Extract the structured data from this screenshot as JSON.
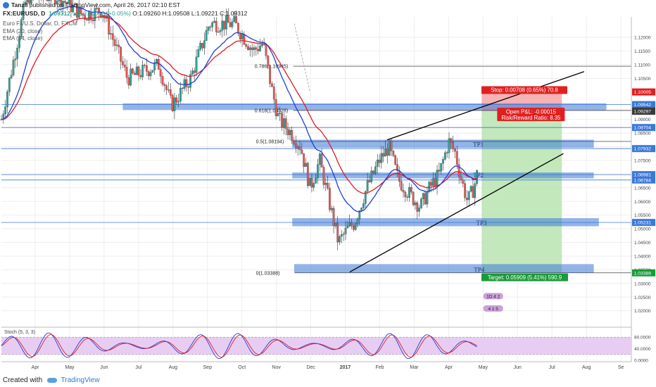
{
  "header": {
    "author": "Tanzil",
    "published_text": "published on TradingView.com, April 26, 2017 02:10 EST",
    "symbol_line": "FX:EURUSD, D",
    "price": "1.09312",
    "change": "+0.00052 (+0.05%)",
    "ohlc": "O:1.09260 H:1.09508 L:1.09221 C:1.09312"
  },
  "legend": {
    "line1": "Euro Fx/U.S. Dollar, D, FXCM",
    "line2": "EMA (20, close)",
    "line3": "EMA (34, close)"
  },
  "colors": {
    "up_candle": "#26a69a",
    "down_candle": "#ef5350",
    "ema20": "#1f3fd6",
    "ema34": "#e01b24",
    "zone": "#3c78d8",
    "stop_zone": "#f4a6a6",
    "target_zone": "#b7e4b0",
    "stoch_band": "#e6c8f2"
  },
  "chart_data": {
    "type": "candlestick",
    "x_labels": [
      "Apr",
      "May",
      "Jun",
      "Jul",
      "Aug",
      "Sep",
      "Oct",
      "Nov",
      "Dec",
      "2017",
      "Feb",
      "Mar",
      "Apr",
      "May",
      "Jun",
      "Jul",
      "Aug",
      "Se"
    ],
    "y_ticks": [
      "1.12000",
      "1.11500",
      "1.11000",
      "1.10500",
      "1.09000",
      "1.08500",
      "1.08000",
      "1.07500",
      "1.07000",
      "1.06500",
      "1.06000",
      "1.05500",
      "1.05000",
      "1.04500",
      "1.04000",
      "1.03500",
      "1.03000",
      "1.02500",
      "1.02000"
    ],
    "y_tick_values": [
      1.12,
      1.115,
      1.11,
      1.105,
      1.09,
      1.085,
      1.08,
      1.075,
      1.07,
      1.065,
      1.06,
      1.055,
      1.05,
      1.045,
      1.04,
      1.035,
      1.03,
      1.025,
      1.02
    ],
    "ylim": [
      1.014,
      1.1275
    ],
    "price_tags": [
      {
        "text": "1.10005",
        "value": 1.10005,
        "color": "#e02020"
      },
      {
        "text": "1.09542",
        "value": 1.09542,
        "color": "#3c78d8"
      },
      {
        "text": "1.09312",
        "value": 1.09312,
        "color": "#5a5a5a"
      },
      {
        "text": "1.09297",
        "value": 1.09297,
        "color": "#3a3a3a"
      },
      {
        "text": "1.08704",
        "value": 1.08704,
        "color": "#3c78d8"
      },
      {
        "text": "1.07932",
        "value": 1.07932,
        "color": "#3c78d8"
      },
      {
        "text": "1.06981",
        "value": 1.06981,
        "color": "#3c78d8"
      },
      {
        "text": "1.06784",
        "value": 1.06784,
        "color": "#3c78d8"
      },
      {
        "text": "1.05231",
        "value": 1.05231,
        "color": "#3c78d8"
      },
      {
        "text": "1.03388",
        "value": 1.03388,
        "color": "#1a9a3a"
      }
    ],
    "fib_levels": [
      {
        "label": "0.786(1.10945)",
        "value": 1.10945
      },
      {
        "label": "0.618(1.09328)",
        "value": 1.09328
      },
      {
        "label": "0.5(1.08194)",
        "value": 1.08194
      },
      {
        "label": "0(1.03388)",
        "value": 1.03388
      }
    ],
    "zones": [
      {
        "label": "",
        "top": 1.0958,
        "bottom": 1.0935,
        "x_start": 0.193,
        "x_end": 0.96
      },
      {
        "label": "TP1",
        "top": 1.0825,
        "bottom": 1.0797,
        "x_start": 0.462,
        "x_end": 0.94
      },
      {
        "label": "TP2",
        "top": 1.0705,
        "bottom": 1.0685,
        "x_start": 0.462,
        "x_end": 0.94
      },
      {
        "label": "TP3",
        "top": 1.0538,
        "bottom": 1.051,
        "x_start": 0.462,
        "x_end": 0.948
      },
      {
        "label": "TP4",
        "top": 1.037,
        "bottom": 1.034,
        "x_start": 0.465,
        "x_end": 0.94
      }
    ],
    "position": {
      "entry": 1.093,
      "stop": 1.1001,
      "target": 1.0339,
      "stop_label": "Stop: 0.00708 (0.65%) 70.8",
      "pnl_label": "Open P&L: -0.00015",
      "rr_label": "Risk/Reward Ratio: 8.35",
      "target_label": "Target: 0.05909 (5.41%) 590.9"
    },
    "stochastic": {
      "label": "Stoch (5, 3, 3)",
      "ticks": [
        "80.0000",
        "40.0000",
        "0.0000"
      ],
      "tick_values": [
        80,
        40,
        0
      ]
    },
    "annotations": [
      "1D 4 2",
      "4 1 5"
    ]
  },
  "footer": {
    "created_with": "Created with",
    "brand": "TradingView"
  }
}
